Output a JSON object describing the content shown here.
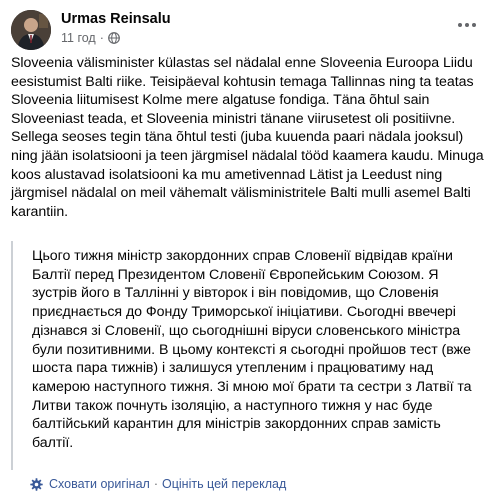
{
  "post": {
    "author_name": "Urmas Reinsalu",
    "timestamp": "11 год",
    "meta_separator": "·",
    "privacy_icon": "globe-icon",
    "more_icon": "more-options-icon",
    "original_text": "Sloveenia välisminister külastas sel nädalal enne Sloveenia Euroopa Liidu eesistumist Balti riike. Teisipäeval kohtusin temaga Tallinnas ning ta teatas Sloveenia liitumisest Kolme mere algatuse fondiga. Täna õhtul  sain Sloveeniast teada, et Sloveenia ministri tänane viirusetest oli positiivne. Sellega seoses tegin täna õhtul testi (juba kuuenda paari nädala jooksul) ning jään isolatsiooni ja teen järgmisel nädalal tööd kaamera kaudu. Minuga koos alustavad isolatsiooni ka mu ametivennad Lätist ja Leedust ning järgmisel nädalal on meil vähemalt välisministritele Balti mulli asemel Balti karantiin.",
    "translated_text": "Цього тижня міністр закордонних справ Словенії відвідав країни Балтії перед Президентом Словенії Європейським Союзом. Я зустрів його в Таллінні у вівторок і він повідомив, що Словенія приєднається до Фонду Триморської ініціативи. Сьогодні ввечері дізнався зі Словенії, що сьогоднішні віруси словенського міністра були позитивними. В цьому контексті я сьогодні пройшов тест (вже шоста пара тижнів) і залишуся утепленим і працюватиму над камерою наступного тижня. Зі мною мої брати та сестри з Латвії та Литви також почнуть ізоляцію, а наступного тижня у нас буде балтійський карантин для міністрів закордонних справ замість балтії.",
    "translation_footer": {
      "icon": "gear-icon",
      "hide_original": "Сховати оригінал",
      "separator": "·",
      "rate_translation": "Оцініть цей переклад"
    }
  }
}
